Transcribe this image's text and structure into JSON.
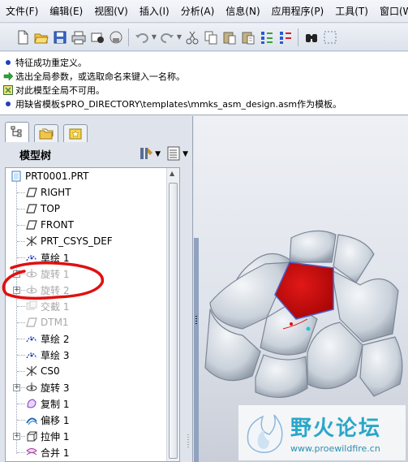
{
  "menubar": {
    "items": [
      "文件(F)",
      "编辑(E)",
      "视图(V)",
      "插入(I)",
      "分析(A)",
      "信息(N)",
      "应用程序(P)",
      "工具(T)",
      "窗口(W)"
    ]
  },
  "toolbar": {
    "buttons": [
      "new-icon",
      "open-icon",
      "save-icon",
      "print-icon",
      "send-mail-icon",
      "email-icon",
      "undo-icon",
      "redo-icon",
      "cut-icon",
      "copy-icon",
      "paste-icon",
      "paste-special-icon",
      "regenerate-icon",
      "regen-manager-icon",
      "find-icon",
      "select-box-icon"
    ]
  },
  "messages": [
    {
      "icon": "info-dot",
      "color": "#1f3fbf",
      "text": "特征成功重定义。"
    },
    {
      "icon": "arrow-right",
      "color": "#2aa23a",
      "text": "选出全局参数，或选取命名来键入一名称。"
    },
    {
      "icon": "warning-square",
      "color": "#3a8c3a",
      "text": "对此模型全局不可用。"
    },
    {
      "icon": "info-dot",
      "color": "#1f3fbf",
      "text": "用缺省模板$PRO_DIRECTORY\\templates\\mmks_asm_design.asm作为模板。"
    }
  ],
  "panel": {
    "tabs": [
      "model-tree-tab-icon",
      "folder-browser-tab-icon",
      "favorites-tab-icon"
    ],
    "tree_title": "模型树"
  },
  "tree": {
    "root": "PRT0001.PRT",
    "items": [
      {
        "label": "RIGHT",
        "icon": "datum-plane-icon",
        "dim": false,
        "expandable": false
      },
      {
        "label": "TOP",
        "icon": "datum-plane-icon",
        "dim": false,
        "expandable": false
      },
      {
        "label": "FRONT",
        "icon": "datum-plane-icon",
        "dim": false,
        "expandable": false
      },
      {
        "label": "PRT_CSYS_DEF",
        "icon": "csys-icon",
        "dim": false,
        "expandable": false
      },
      {
        "label": "草绘 1",
        "icon": "sketch-icon",
        "dim": false,
        "expandable": false
      },
      {
        "label": "旋转 1",
        "icon": "revolve-icon",
        "dim": true,
        "expandable": true
      },
      {
        "label": "旋转 2",
        "icon": "revolve-icon",
        "dim": true,
        "expandable": true
      },
      {
        "label": "交截 1",
        "icon": "intersect-icon",
        "dim": true,
        "expandable": false
      },
      {
        "label": "DTM1",
        "icon": "datum-plane-icon",
        "dim": true,
        "expandable": false
      },
      {
        "label": "草绘 2",
        "icon": "sketch-icon",
        "dim": false,
        "expandable": false
      },
      {
        "label": "草绘 3",
        "icon": "sketch-icon",
        "dim": false,
        "expandable": false
      },
      {
        "label": "CS0",
        "icon": "csys-icon",
        "dim": false,
        "expandable": false
      },
      {
        "label": "旋转 3",
        "icon": "revolve-icon",
        "dim": false,
        "expandable": true
      },
      {
        "label": "复制 1",
        "icon": "copy-feature-icon",
        "dim": false,
        "expandable": false
      },
      {
        "label": "偏移 1",
        "icon": "offset-icon",
        "dim": false,
        "expandable": false
      },
      {
        "label": "拉伸 1",
        "icon": "extrude-icon",
        "dim": false,
        "expandable": true
      },
      {
        "label": "合并 1",
        "icon": "merge-icon",
        "dim": false,
        "expandable": false
      }
    ]
  },
  "colors": {
    "highlight_face": "#d31010",
    "annotation": "#e01010",
    "ball_surface": "#c9d1da"
  },
  "watermark": {
    "title": "野火论坛",
    "url": "www.proewildfire.cn"
  }
}
